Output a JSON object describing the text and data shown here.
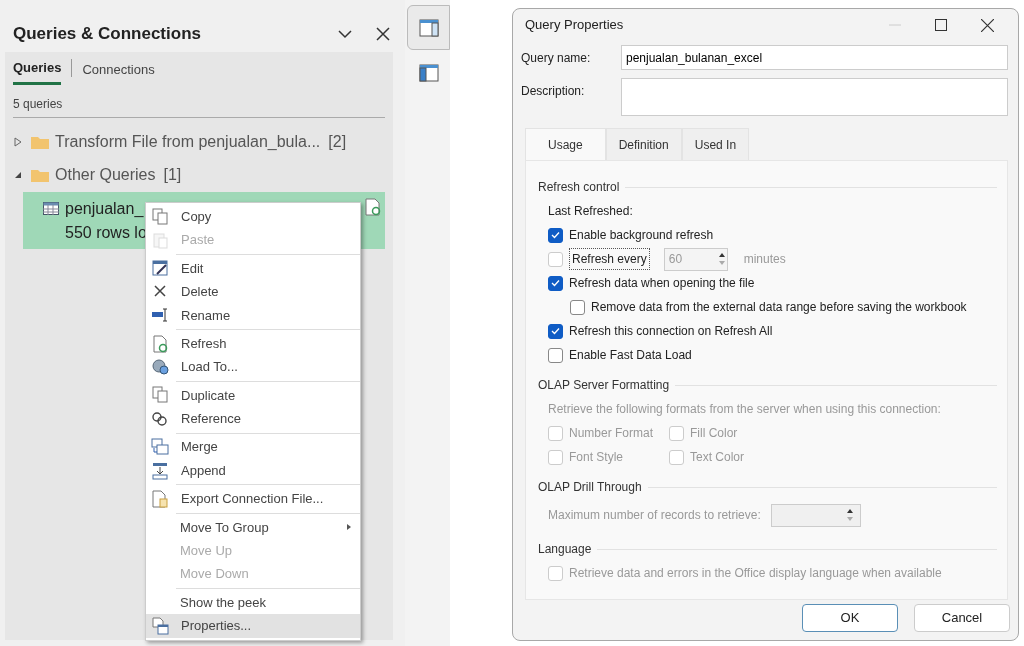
{
  "pane": {
    "title": "Queries & Connections",
    "tabs": [
      {
        "label": "Queries",
        "selected": true
      },
      {
        "label": "Connections",
        "selected": false
      }
    ],
    "count": "5 queries",
    "tree": [
      {
        "label": "Transform File from penjualan_bula...",
        "count": "[2]",
        "expanded": false
      },
      {
        "label": "Other Queries",
        "count": "[1]",
        "expanded": true,
        "children": [
          {
            "label": "penjualan_",
            "detail": "550 rows lo",
            "selected": true
          }
        ]
      }
    ]
  },
  "context_menu": {
    "groups": [
      [
        {
          "label": "Copy",
          "disabled": false,
          "selected": false
        },
        {
          "label": "Paste",
          "disabled": true,
          "selected": false
        }
      ],
      [
        {
          "label": "Edit",
          "disabled": false,
          "selected": false
        },
        {
          "label": "Delete",
          "disabled": false,
          "selected": false
        },
        {
          "label": "Rename",
          "disabled": false,
          "selected": false
        }
      ],
      [
        {
          "label": "Refresh",
          "disabled": false,
          "selected": false
        },
        {
          "label": "Load To...",
          "disabled": false,
          "selected": false
        }
      ],
      [
        {
          "label": "Duplicate",
          "disabled": false,
          "selected": false
        },
        {
          "label": "Reference",
          "disabled": false,
          "selected": false
        }
      ],
      [
        {
          "label": "Merge",
          "disabled": false,
          "selected": false
        },
        {
          "label": "Append",
          "disabled": false,
          "selected": false
        }
      ],
      [
        {
          "label": "Export Connection File...",
          "disabled": false,
          "selected": false
        }
      ],
      [
        {
          "label": "Move To Group",
          "disabled": false,
          "selected": false,
          "submenu": true
        },
        {
          "label": "Move Up",
          "disabled": true,
          "selected": false
        },
        {
          "label": "Move Down",
          "disabled": true,
          "selected": false
        }
      ],
      [
        {
          "label": "Show the peek",
          "disabled": false,
          "selected": false
        },
        {
          "label": "Properties...",
          "disabled": false,
          "selected": true
        }
      ]
    ]
  },
  "dialog": {
    "title": "Query Properties",
    "fields": [
      {
        "label": "Query name:",
        "value": "penjualan_bulanan_excel",
        "multiline": false
      },
      {
        "label": "Description:",
        "multiline": true
      }
    ],
    "tabs": [
      {
        "label": "Usage",
        "selected": true
      },
      {
        "label": "Definition",
        "selected": false
      },
      {
        "label": "Used In",
        "selected": false
      }
    ],
    "sections": [
      {
        "title": "Refresh control",
        "rows": [
          {
            "kind": "text",
            "text": "Last Refreshed:",
            "disabled": false
          },
          {
            "kind": "checkbox",
            "label": "Enable background refresh",
            "checked": true,
            "disabled": false
          },
          {
            "kind": "spin",
            "label": "Refresh every",
            "checked": false,
            "focused": true,
            "value": "60",
            "unit": "minutes",
            "disabled": true
          },
          {
            "kind": "checkbox",
            "label": "Refresh data when opening the file",
            "checked": true,
            "disabled": false,
            "children": [
              {
                "kind": "checkbox",
                "label": "Remove data from the external data range before saving the workbook",
                "checked": false,
                "disabled": false
              }
            ]
          },
          {
            "kind": "checkbox",
            "label": "Refresh this connection on Refresh All",
            "checked": true,
            "disabled": false
          },
          {
            "kind": "checkbox",
            "label": "Enable Fast Data Load",
            "checked": false,
            "disabled": false
          }
        ]
      },
      {
        "title": "OLAP Server Formatting",
        "rows": [
          {
            "kind": "text",
            "text": "Retrieve the following formats from the server when using this connection:",
            "disabled": true
          },
          {
            "kind": "grid",
            "items": [
              {
                "label": "Number Format",
                "checked": false,
                "disabled": true
              },
              {
                "label": "Fill Color",
                "checked": false,
                "disabled": true
              },
              {
                "label": "Font Style",
                "checked": false,
                "disabled": true
              },
              {
                "label": "Text Color",
                "checked": false,
                "disabled": true
              }
            ]
          }
        ]
      },
      {
        "title": "OLAP Drill Through",
        "rows": [
          {
            "kind": "number",
            "label": "Maximum number of records to retrieve:",
            "disabled": true
          }
        ]
      },
      {
        "title": "Language",
        "rows": [
          {
            "kind": "checkbox",
            "label": "Retrieve data and errors in the Office display language when available",
            "checked": false,
            "disabled": true
          }
        ]
      }
    ],
    "buttons": [
      {
        "label": "OK",
        "default": true
      },
      {
        "label": "Cancel",
        "default": false
      }
    ]
  }
}
